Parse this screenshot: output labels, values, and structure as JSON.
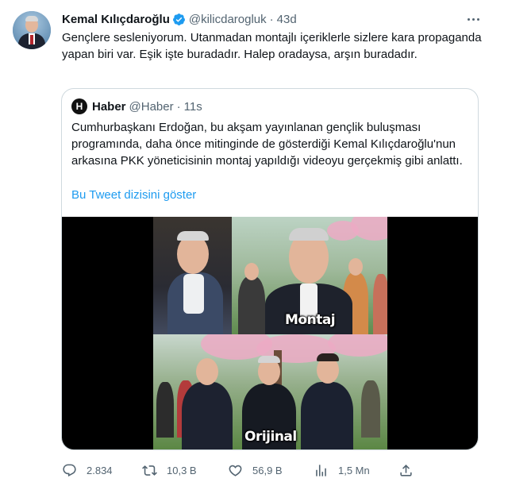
{
  "tweet": {
    "author_name": "Kemal Kılıçdaroğlu",
    "author_handle": "@kilicdarogluk",
    "separator": "·",
    "time": "43d",
    "text": "Gençlere sesleniyorum. Utanmadan montajlı içeriklerle sizlere kara propaganda yapan biri var. Eşik işte buradadır. Halep oradaysa, arşın buradadır."
  },
  "quote": {
    "avatar_letter": "H",
    "name": "Haber",
    "handle": "@Haber",
    "separator": "·",
    "time": "11s",
    "text": "Cumhurbaşkanı Erdoğan, bu akşam yayınlanan gençlik buluşması programında, daha önce mitinginde de gösterdiği Kemal Kılıçdaroğlu'nun arkasına PKK yöneticisinin montaj yapıldığı videoyu gerçekmiş gibi anlattı.",
    "thread_link": "Bu Tweet dizisini göster",
    "media": {
      "caption_top": "Montaj",
      "caption_bottom": "Orijinal"
    }
  },
  "actions": {
    "replies": "2.834",
    "retweets": "10,3 B",
    "likes": "56,9 B",
    "views": "1,5 Mn"
  },
  "icons": [
    "verified-badge-icon",
    "more-icon",
    "reply-icon",
    "retweet-icon",
    "like-icon",
    "views-icon",
    "share-icon"
  ],
  "colors": {
    "link": "#1d9bf0",
    "secondary_text": "#536471",
    "border": "#cfd9de",
    "verified": "#1d9bf0"
  }
}
